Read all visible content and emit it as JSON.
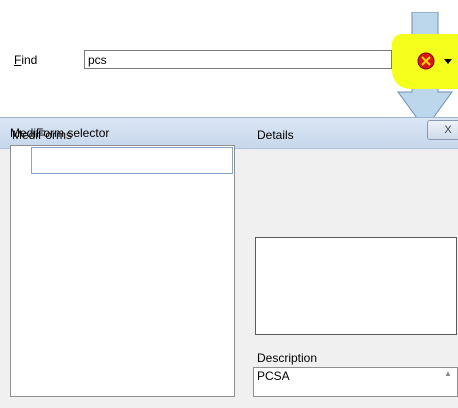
{
  "window": {
    "title": "MediForm selector",
    "close_glyph": "X"
  },
  "find": {
    "label_key": "F",
    "label_rest": "ind",
    "value": "pcs"
  },
  "panels": {
    "mediforms_label": "MediForms",
    "details_label": "Details",
    "description_label": "Description",
    "description_value": "PCSA"
  },
  "toolbar": {
    "icon": "clear-search-icon",
    "dropdown_icon": "chevron-down-icon"
  },
  "annotation": {
    "arrow_color": "#bcd6ec",
    "highlight_color": "#f4ff1c"
  }
}
